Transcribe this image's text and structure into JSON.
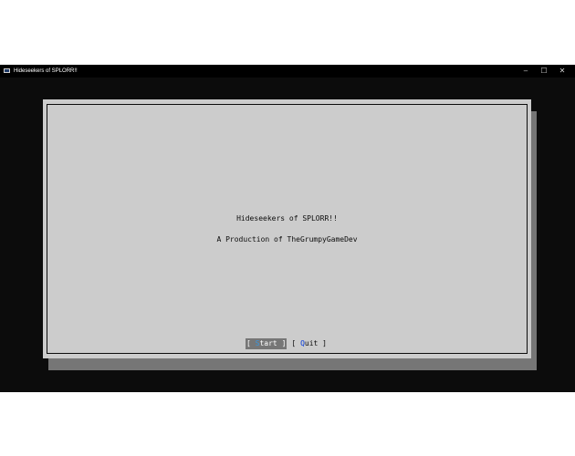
{
  "window": {
    "title": "Hideseekers of SPLORR!!",
    "controls": {
      "minimize": "–",
      "maximize": "☐",
      "close": "✕"
    }
  },
  "dialog": {
    "title": "Hideseekers of SPLORR!!",
    "subtitle": "A Production of TheGrumpyGameDev",
    "buttons": {
      "start": {
        "open_bracket": "[",
        "hotkey": "S",
        "rest": "tart",
        "close_bracket": "]"
      },
      "quit": {
        "open_bracket": "[",
        "hotkey": "Q",
        "rest": "uit",
        "close_bracket": "]"
      }
    }
  },
  "colors": {
    "console_bg": "#0c0c0c",
    "dialog_bg": "#cccccc",
    "shadow": "#767676",
    "selected_button_bg": "#767676",
    "hotkey": "#3a96dd"
  }
}
